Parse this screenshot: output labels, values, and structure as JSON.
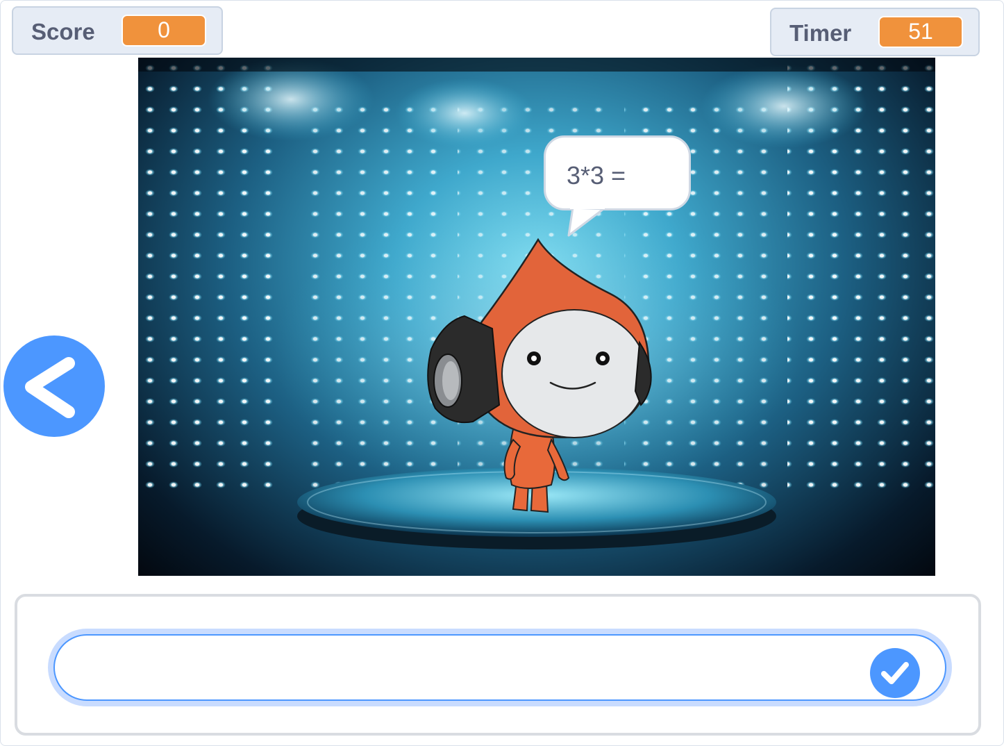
{
  "monitors": {
    "score": {
      "label": "Score",
      "value": "0"
    },
    "timer": {
      "label": "Timer",
      "value": "51"
    }
  },
  "stage": {
    "backdrop": "spotlight-stage",
    "sprite": {
      "name": "pico-character",
      "icon": "character-sprite"
    },
    "speech_bubble": "3*3 ="
  },
  "navigation": {
    "back_icon": "chevron-left-icon"
  },
  "answer": {
    "value": "",
    "placeholder": "",
    "submit_icon": "check-icon"
  },
  "colors": {
    "monitor_value": "#f0923c",
    "accent": "#4c97ff",
    "monitor_label": "#575e75"
  }
}
